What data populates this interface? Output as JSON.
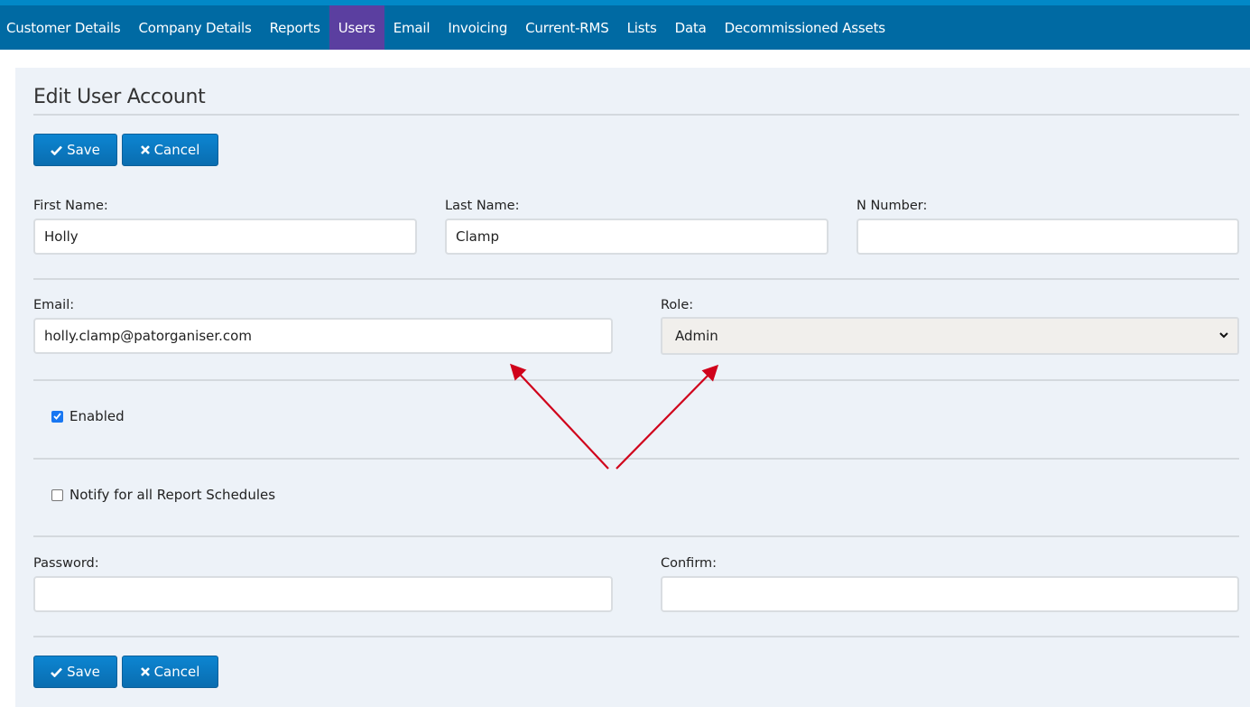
{
  "nav": {
    "items": [
      {
        "label": "Customer Details",
        "active": false
      },
      {
        "label": "Company Details",
        "active": false
      },
      {
        "label": "Reports",
        "active": false
      },
      {
        "label": "Users",
        "active": true
      },
      {
        "label": "Email",
        "active": false
      },
      {
        "label": "Invoicing",
        "active": false
      },
      {
        "label": "Current-RMS",
        "active": false
      },
      {
        "label": "Lists",
        "active": false
      },
      {
        "label": "Data",
        "active": false
      },
      {
        "label": "Decommissioned Assets",
        "active": false
      }
    ]
  },
  "page": {
    "title": "Edit User Account"
  },
  "toolbar": {
    "save_label": "Save",
    "cancel_label": "Cancel"
  },
  "form": {
    "first_name": {
      "label": "First Name:",
      "value": "Holly"
    },
    "last_name": {
      "label": "Last Name:",
      "value": "Clamp"
    },
    "n_number": {
      "label": "N Number:",
      "value": ""
    },
    "email": {
      "label": "Email:",
      "value": "holly.clamp@patorganiser.com"
    },
    "role": {
      "label": "Role:",
      "value": "Admin"
    },
    "enabled": {
      "label": "Enabled",
      "checked": true
    },
    "notify": {
      "label": "Notify for all Report Schedules",
      "checked": false
    },
    "password": {
      "label": "Password:",
      "value": ""
    },
    "confirm": {
      "label": "Confirm:",
      "value": ""
    }
  },
  "colors": {
    "nav_bg": "#006aa3",
    "nav_active": "#5b3fa0",
    "button": "#0a76bd",
    "annotation_arrow": "#d0021b"
  },
  "icons": {
    "save": "check-icon",
    "cancel": "x-icon",
    "role_dropdown": "chevron-down-icon"
  }
}
